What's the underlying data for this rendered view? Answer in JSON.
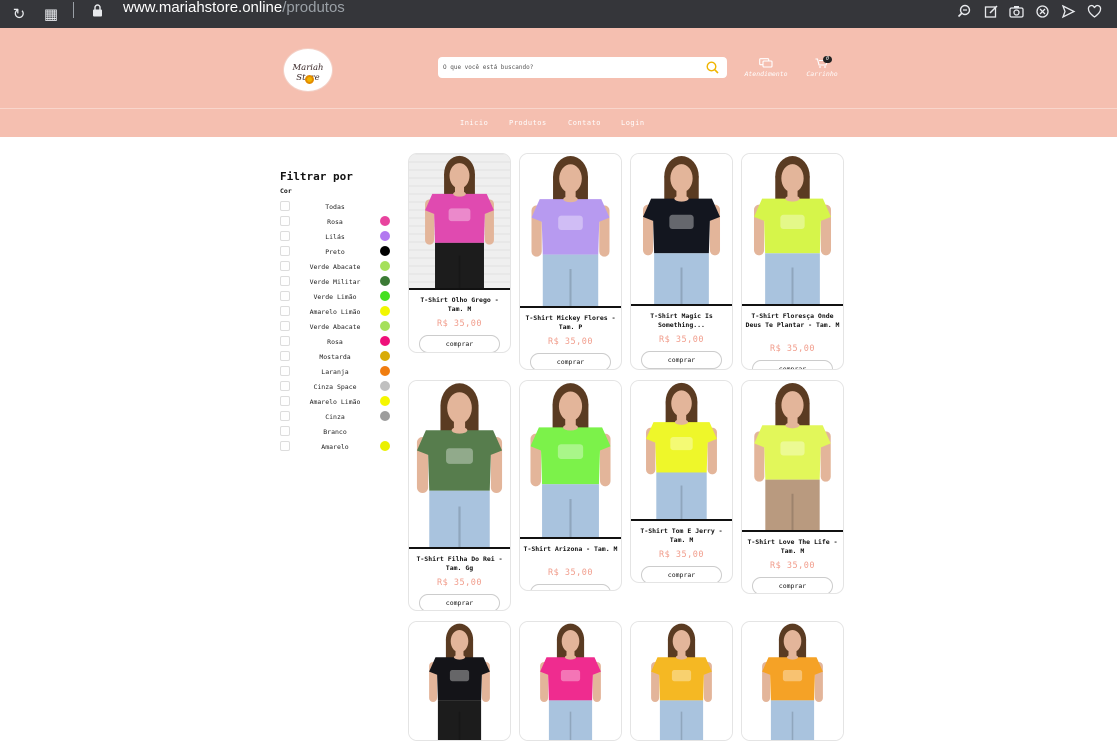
{
  "browser": {
    "url_host": "www.mariahstore.online",
    "url_path": "/produtos"
  },
  "header": {
    "logo_text": "Mariah Store",
    "search_placeholder": "O que você está buscando?",
    "atendimento_label": "Atendimento",
    "carrinho_label": "Carrinho",
    "cart_count": "0"
  },
  "nav": [
    "Inicio",
    "Produtos",
    "Contato",
    "Login"
  ],
  "filter": {
    "title": "Filtrar por",
    "subtitle": "Cor",
    "options": [
      {
        "label": "Todas",
        "color": null
      },
      {
        "label": "Rosa",
        "color": "#e8439e"
      },
      {
        "label": "Lilás",
        "color": "#b278f0"
      },
      {
        "label": "Preto",
        "color": "#000000"
      },
      {
        "label": "Verde Abacate",
        "color": "#a5e05a"
      },
      {
        "label": "Verde Militar",
        "color": "#3b7a35"
      },
      {
        "label": "Verde Limão",
        "color": "#43e01f"
      },
      {
        "label": "Amarelo Limão",
        "color": "#f2f700"
      },
      {
        "label": "Verde Abacate",
        "color": "#a5e05a"
      },
      {
        "label": "Rosa",
        "color": "#ef107a"
      },
      {
        "label": "Mostarda",
        "color": "#d8ab07"
      },
      {
        "label": "Laranja",
        "color": "#f07d0f"
      },
      {
        "label": "Cinza Space",
        "color": "#c0c0c0"
      },
      {
        "label": "Amarelo Limão",
        "color": "#f5f700"
      },
      {
        "label": "Cinza",
        "color": "#9d9d9d"
      },
      {
        "label": "Branco",
        "color": null
      },
      {
        "label": "Amarelo",
        "color": "#eaf000"
      }
    ]
  },
  "products": [
    {
      "name": "T-Shirt Olho Grego - Tam. M",
      "price": "R$ 35,00",
      "button": "comprar",
      "shirt_color": "#e04ab0",
      "bg": "#efefef"
    },
    {
      "name": "T-Shirt Mickey Flores - Tam. P",
      "price": "R$ 35,00",
      "button": "comprar",
      "shirt_color": "#b79af0",
      "bg": "#ffffff"
    },
    {
      "name": "T-Shirt Magic Is Something...",
      "price": "R$ 35,00",
      "button": "comprar",
      "shirt_color": "#13161f",
      "bg": "#ffffff"
    },
    {
      "name": "T-Shirt Floresça Onde Deus Te Plantar - Tam. M",
      "price": "R$ 35,00",
      "button": "comprar",
      "shirt_color": "#d6f54a",
      "bg": "#ffffff"
    },
    {
      "name": "T-Shirt Filha Do Rei - Tam. Gg",
      "price": "R$ 35,00",
      "button": "comprar",
      "shirt_color": "#577d4d",
      "bg": "#ffffff"
    },
    {
      "name": "T-Shirt Arizona - Tam. M",
      "price": "R$ 35,00",
      "button": "comprar",
      "shirt_color": "#7cf24a",
      "bg": "#ffffff"
    },
    {
      "name": "T-Shirt Tom E Jerry - Tam. M",
      "price": "R$ 35,00",
      "button": "comprar",
      "shirt_color": "#eef72a",
      "bg": "#ffffff"
    },
    {
      "name": "T-Shirt Love The Life - Tam. M",
      "price": "R$ 35,00",
      "button": "comprar",
      "shirt_color": "#e2f75a",
      "bg": "#ffffff"
    },
    {
      "shirt_color": "#141418",
      "bg": "#ffffff"
    },
    {
      "shirt_color": "#ef2c8f",
      "bg": "#ffffff"
    },
    {
      "shirt_color": "#f5b823",
      "bg": "#ffffff"
    },
    {
      "shirt_color": "#f5a226",
      "bg": "#ffffff"
    }
  ]
}
